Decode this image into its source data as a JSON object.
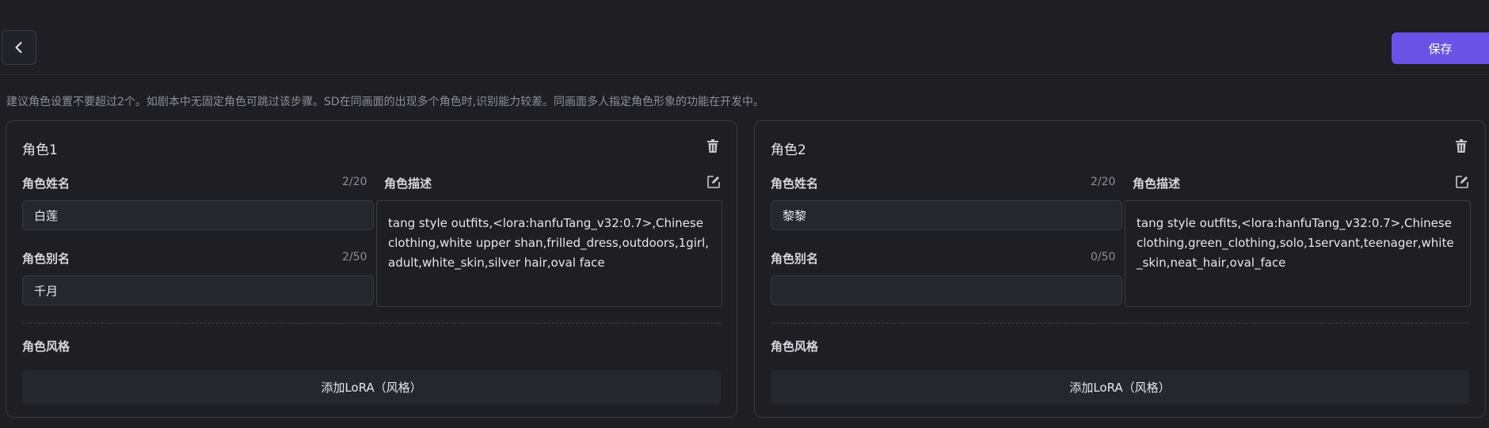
{
  "header": {
    "save_label": "保存"
  },
  "hint": "建议角色设置不要超过2个。如剧本中无固定角色可跳过该步骤。SD在同画面的出现多个角色时,识别能力较差。同画面多人指定角色形象的功能在开发中。",
  "labels": {
    "name": "角色姓名",
    "desc": "角色描述",
    "alias": "角色别名",
    "style": "角色风格",
    "add_lora": "添加LoRA（风格）"
  },
  "roles": [
    {
      "title": "角色1",
      "name": "白莲",
      "name_count": "2/20",
      "alias": "千月",
      "alias_count": "2/50",
      "description": "tang style outfits,<lora:hanfuTang_v32:0.7>,Chinese clothing,white upper shan,frilled_dress,outdoors,1girl,adult,white_skin,silver hair,oval face"
    },
    {
      "title": "角色2",
      "name": "黎黎",
      "name_count": "2/20",
      "alias": "",
      "alias_count": "0/50",
      "description": "tang style outfits,<lora:hanfuTang_v32:0.7>,Chinese clothing,green_clothing,solo,1servant,teenager,white_skin,neat_hair,oval_face"
    }
  ],
  "colors": {
    "accent": "#6b52e6",
    "background": "#1e1e23",
    "border": "#3a3a42"
  }
}
